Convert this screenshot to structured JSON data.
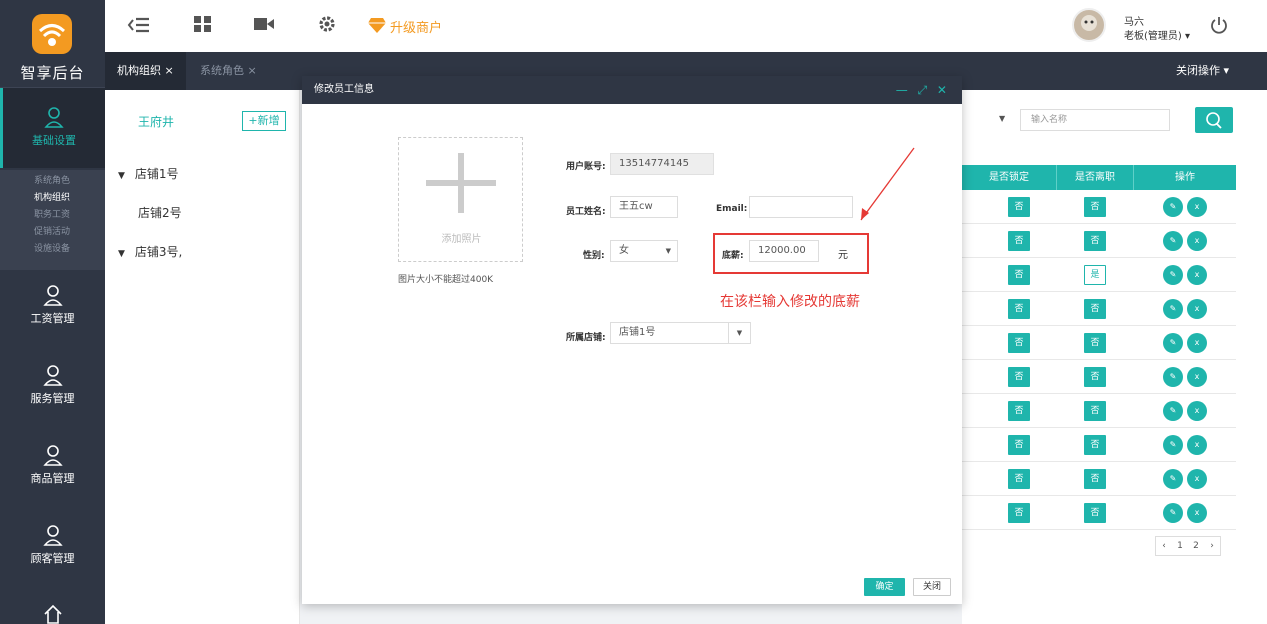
{
  "brand": {
    "name": "智享后台"
  },
  "sidebar": {
    "items": [
      {
        "label": "基础设置"
      },
      {
        "label": "工资管理"
      },
      {
        "label": "服务管理"
      },
      {
        "label": "商品管理"
      },
      {
        "label": "顾客管理"
      }
    ],
    "submenu": [
      "系统角色",
      "机构组织",
      "职务工资",
      "促销活动",
      "设施设备"
    ],
    "active_sub": "机构组织"
  },
  "topbar": {
    "upgrade_label": "升级商户",
    "user_name": "马六",
    "user_role": "老板(管理员) ▾"
  },
  "tabs": [
    {
      "label": "机构组织 ×"
    },
    {
      "label": "系统角色 ×"
    }
  ],
  "close_ops": "关闭操作 ▾",
  "left_panel": {
    "title": "王府井",
    "add_label": "+新增",
    "tree": [
      {
        "label": "店铺1号",
        "arrow": "▼"
      },
      {
        "label": "店铺2号",
        "arrow": ""
      },
      {
        "label": "店铺3号,",
        "arrow": "▼"
      }
    ]
  },
  "right_panel": {
    "search_placeholder": "输入名称",
    "columns": [
      "是否锁定",
      "是否离职",
      "操作"
    ],
    "rows": [
      {
        "locked": "否",
        "resigned": "否"
      },
      {
        "locked": "否",
        "resigned": "否"
      },
      {
        "locked": "否",
        "resigned": "是"
      },
      {
        "locked": "否",
        "resigned": "否"
      },
      {
        "locked": "否",
        "resigned": "否"
      },
      {
        "locked": "否",
        "resigned": "否"
      },
      {
        "locked": "否",
        "resigned": "否"
      },
      {
        "locked": "否",
        "resigned": "否"
      },
      {
        "locked": "否",
        "resigned": "否"
      },
      {
        "locked": "否",
        "resigned": "否"
      }
    ],
    "pager": [
      "‹",
      "1",
      "2",
      "›"
    ]
  },
  "modal": {
    "title": "修改员工信息",
    "controls": "— ⤢ ✕",
    "photo_label": "添加照片",
    "photo_note": "图片大小不能超过400K",
    "account_label": "用户账号:",
    "account_value": "13514774145",
    "name_label": "员工姓名:",
    "name_value": "王五cw",
    "email_label": "Email:",
    "email_value": "",
    "gender_label": "性别:",
    "gender_value": "女",
    "salary_label": "底薪:",
    "salary_value": "12000.00",
    "salary_unit": "元",
    "store_label": "所属店铺:",
    "store_value": "店铺1号",
    "annotation": "在该栏输入修改的底薪",
    "ok_label": "确定",
    "close_label": "关闭"
  },
  "colors": {
    "accent": "#1fb5ac",
    "sidebar": "#2f3644",
    "warning": "#f39a21",
    "annotation": "#e53935"
  }
}
